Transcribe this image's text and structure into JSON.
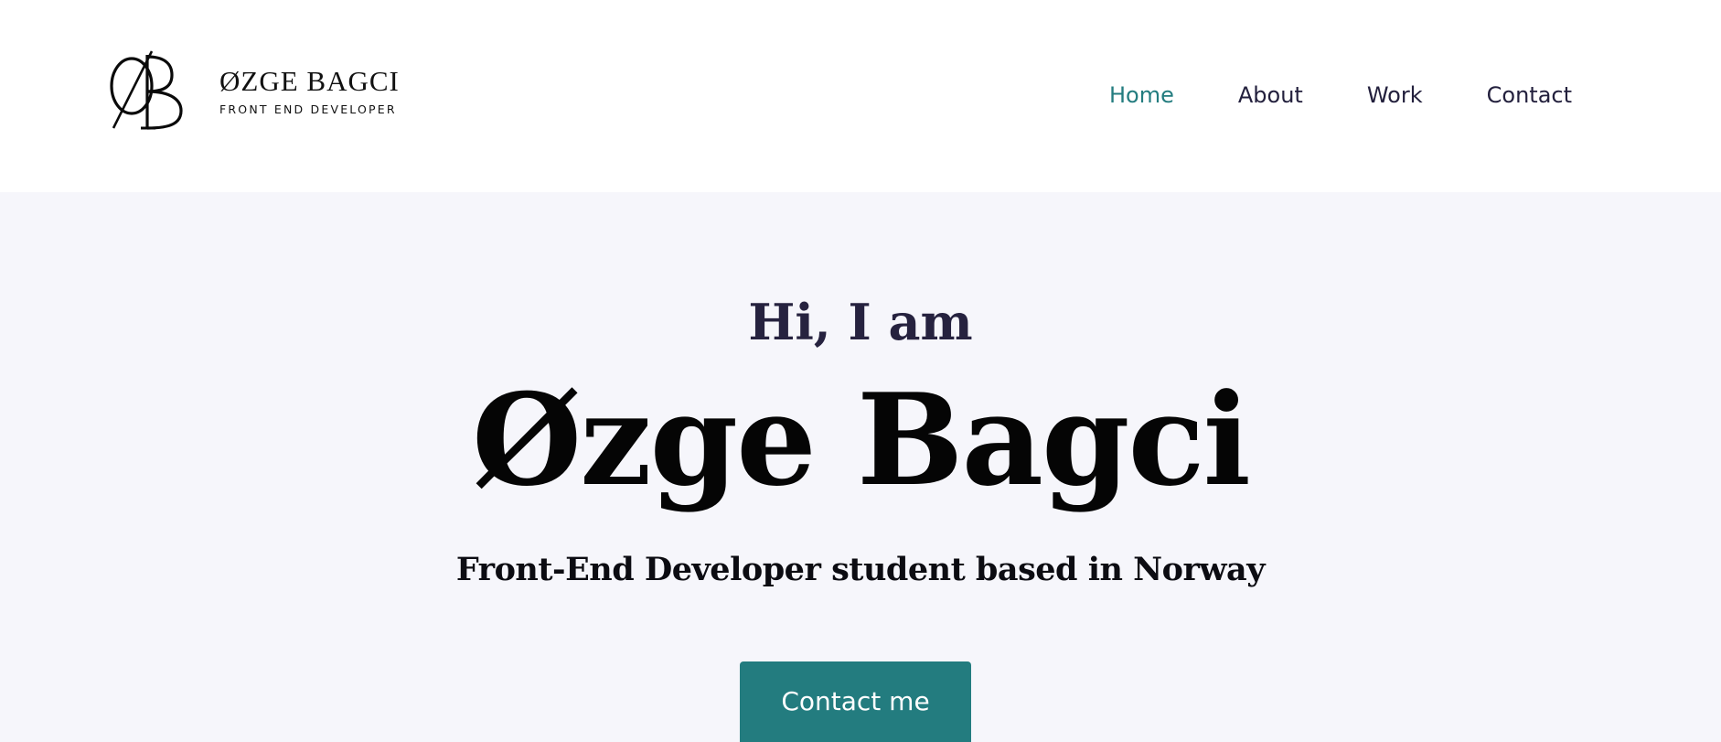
{
  "brand": {
    "name": "ØZGE BAGCI",
    "subtitle": "FRONT END DEVELOPER",
    "monogram": "ØB",
    "logo_icon": "ob-monogram-icon"
  },
  "nav": {
    "items": [
      {
        "label": "Home",
        "active": true
      },
      {
        "label": "About",
        "active": false
      },
      {
        "label": "Work",
        "active": false
      },
      {
        "label": "Contact",
        "active": false
      }
    ]
  },
  "hero": {
    "greeting": "Hi, I am",
    "name": "Øzge Bagci",
    "tagline": "Front-End Developer student based in Norway",
    "cta_label": "Contact me"
  },
  "colors": {
    "accent": "#237c7f",
    "nav_text": "#23203d",
    "hero_background": "#f6f6fb",
    "header_background": "#ffffff",
    "heading_dark": "#26223f",
    "button_text": "#ffffff"
  }
}
